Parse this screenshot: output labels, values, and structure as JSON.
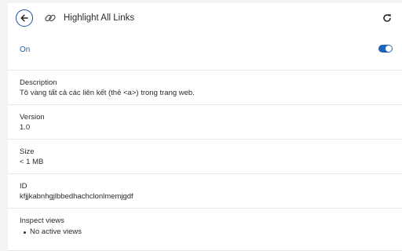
{
  "header": {
    "back_icon": "arrow-left-icon",
    "extension_icon": "link-icon",
    "title": "Highlight All Links",
    "reload_icon": "reload-icon"
  },
  "toggle": {
    "label": "On",
    "enabled": true,
    "accent": "#1f63b8"
  },
  "details": {
    "description": {
      "label": "Description",
      "value": "Tô vàng tất cả các liên kết (thẻ <a>) trong trang web."
    },
    "version": {
      "label": "Version",
      "value": "1.0"
    },
    "size": {
      "label": "Size",
      "value": "< 1 MB"
    },
    "id": {
      "label": "ID",
      "value": "kfjjkabnhgjlbbedhachclonlmemjgdf"
    },
    "inspect": {
      "label": "Inspect views",
      "items": [
        "No active views"
      ]
    }
  }
}
